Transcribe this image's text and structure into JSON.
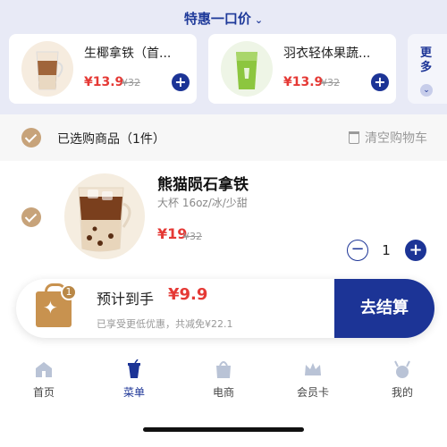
{
  "promo": {
    "title": "特惠一口价",
    "products": [
      {
        "name": "生椰拿铁（首...",
        "price": "¥13.9",
        "original_price": "¥32"
      },
      {
        "name": "羽衣轻体果蔬...",
        "price": "¥13.9",
        "original_price": "¥32"
      }
    ],
    "more_label": "更多"
  },
  "cart": {
    "selected_label": "已选购商品（1件）",
    "clear_label": "清空购物车",
    "item": {
      "name": "熊猫陨石拿铁",
      "spec": "大杯 16oz/冰/少甜",
      "price": "¥19",
      "original_price": "¥32",
      "quantity": "1"
    }
  },
  "checkout": {
    "badge_count": "1",
    "estimate_label": "预计到手",
    "estimate_price": "¥9.9",
    "discount_text": "已享受更低优惠，共减免¥22.1",
    "pay_label": "去结算"
  },
  "nav": {
    "items": [
      {
        "label": "首页",
        "icon": "home-icon"
      },
      {
        "label": "菜单",
        "icon": "drink-cup-icon",
        "active": true
      },
      {
        "label": "电商",
        "icon": "shopping-bag-icon"
      },
      {
        "label": "会员卡",
        "icon": "crown-icon"
      },
      {
        "label": "我的",
        "icon": "deer-icon"
      }
    ]
  },
  "colors": {
    "accent": "#1c3496",
    "price": "#e53935",
    "check": "#c7a37a",
    "promo_bg": "#e8eaf6"
  }
}
